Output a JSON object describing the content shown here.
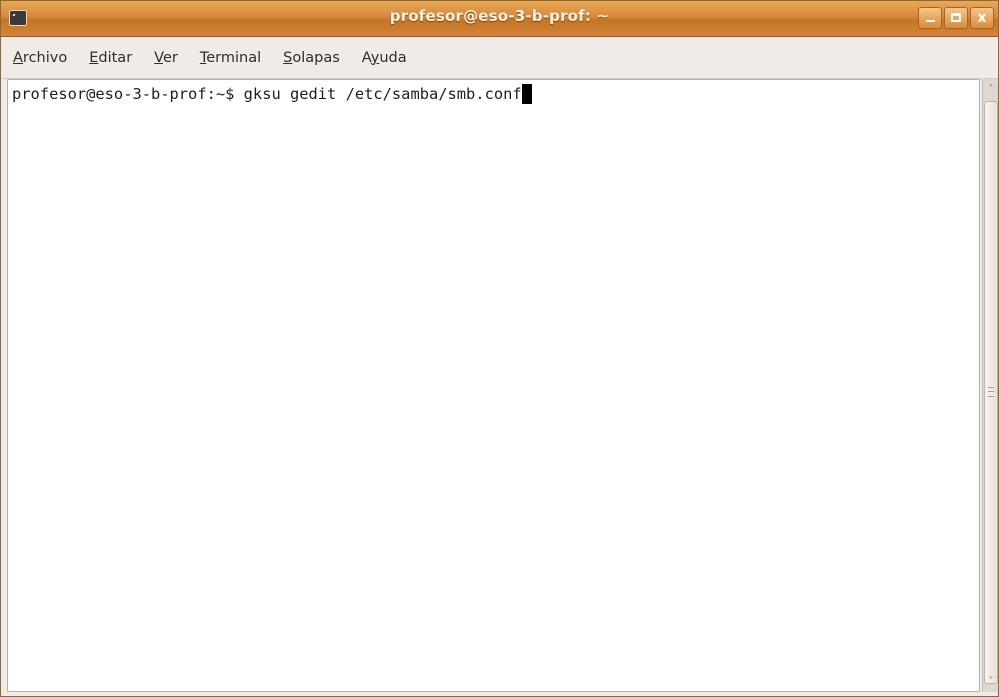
{
  "window": {
    "title": "profesor@eso-3-b-prof: ~",
    "icon": "terminal-icon",
    "controls": {
      "minimize_icon": "minimize-icon",
      "maximize_icon": "maximize-icon",
      "close_icon": "close-icon",
      "close_glyph": "x"
    },
    "accent_color": "#d7883a"
  },
  "menubar": {
    "items": [
      {
        "mnemonic": "A",
        "rest": "rchivo"
      },
      {
        "mnemonic": "E",
        "rest": "ditar"
      },
      {
        "mnemonic": "V",
        "rest": "er"
      },
      {
        "mnemonic": "T",
        "rest": "erminal"
      },
      {
        "mnemonic": "S",
        "rest": "olapas"
      },
      {
        "pre": "A",
        "mnemonic": "y",
        "rest": "uda"
      }
    ]
  },
  "terminal": {
    "prompt": "profesor@eso-3-b-prof:~$ ",
    "command": "gksu gedit /etc/samba/smb.conf"
  },
  "scrollbar": {
    "up_arrow": "˄",
    "down_arrow": "˅"
  }
}
